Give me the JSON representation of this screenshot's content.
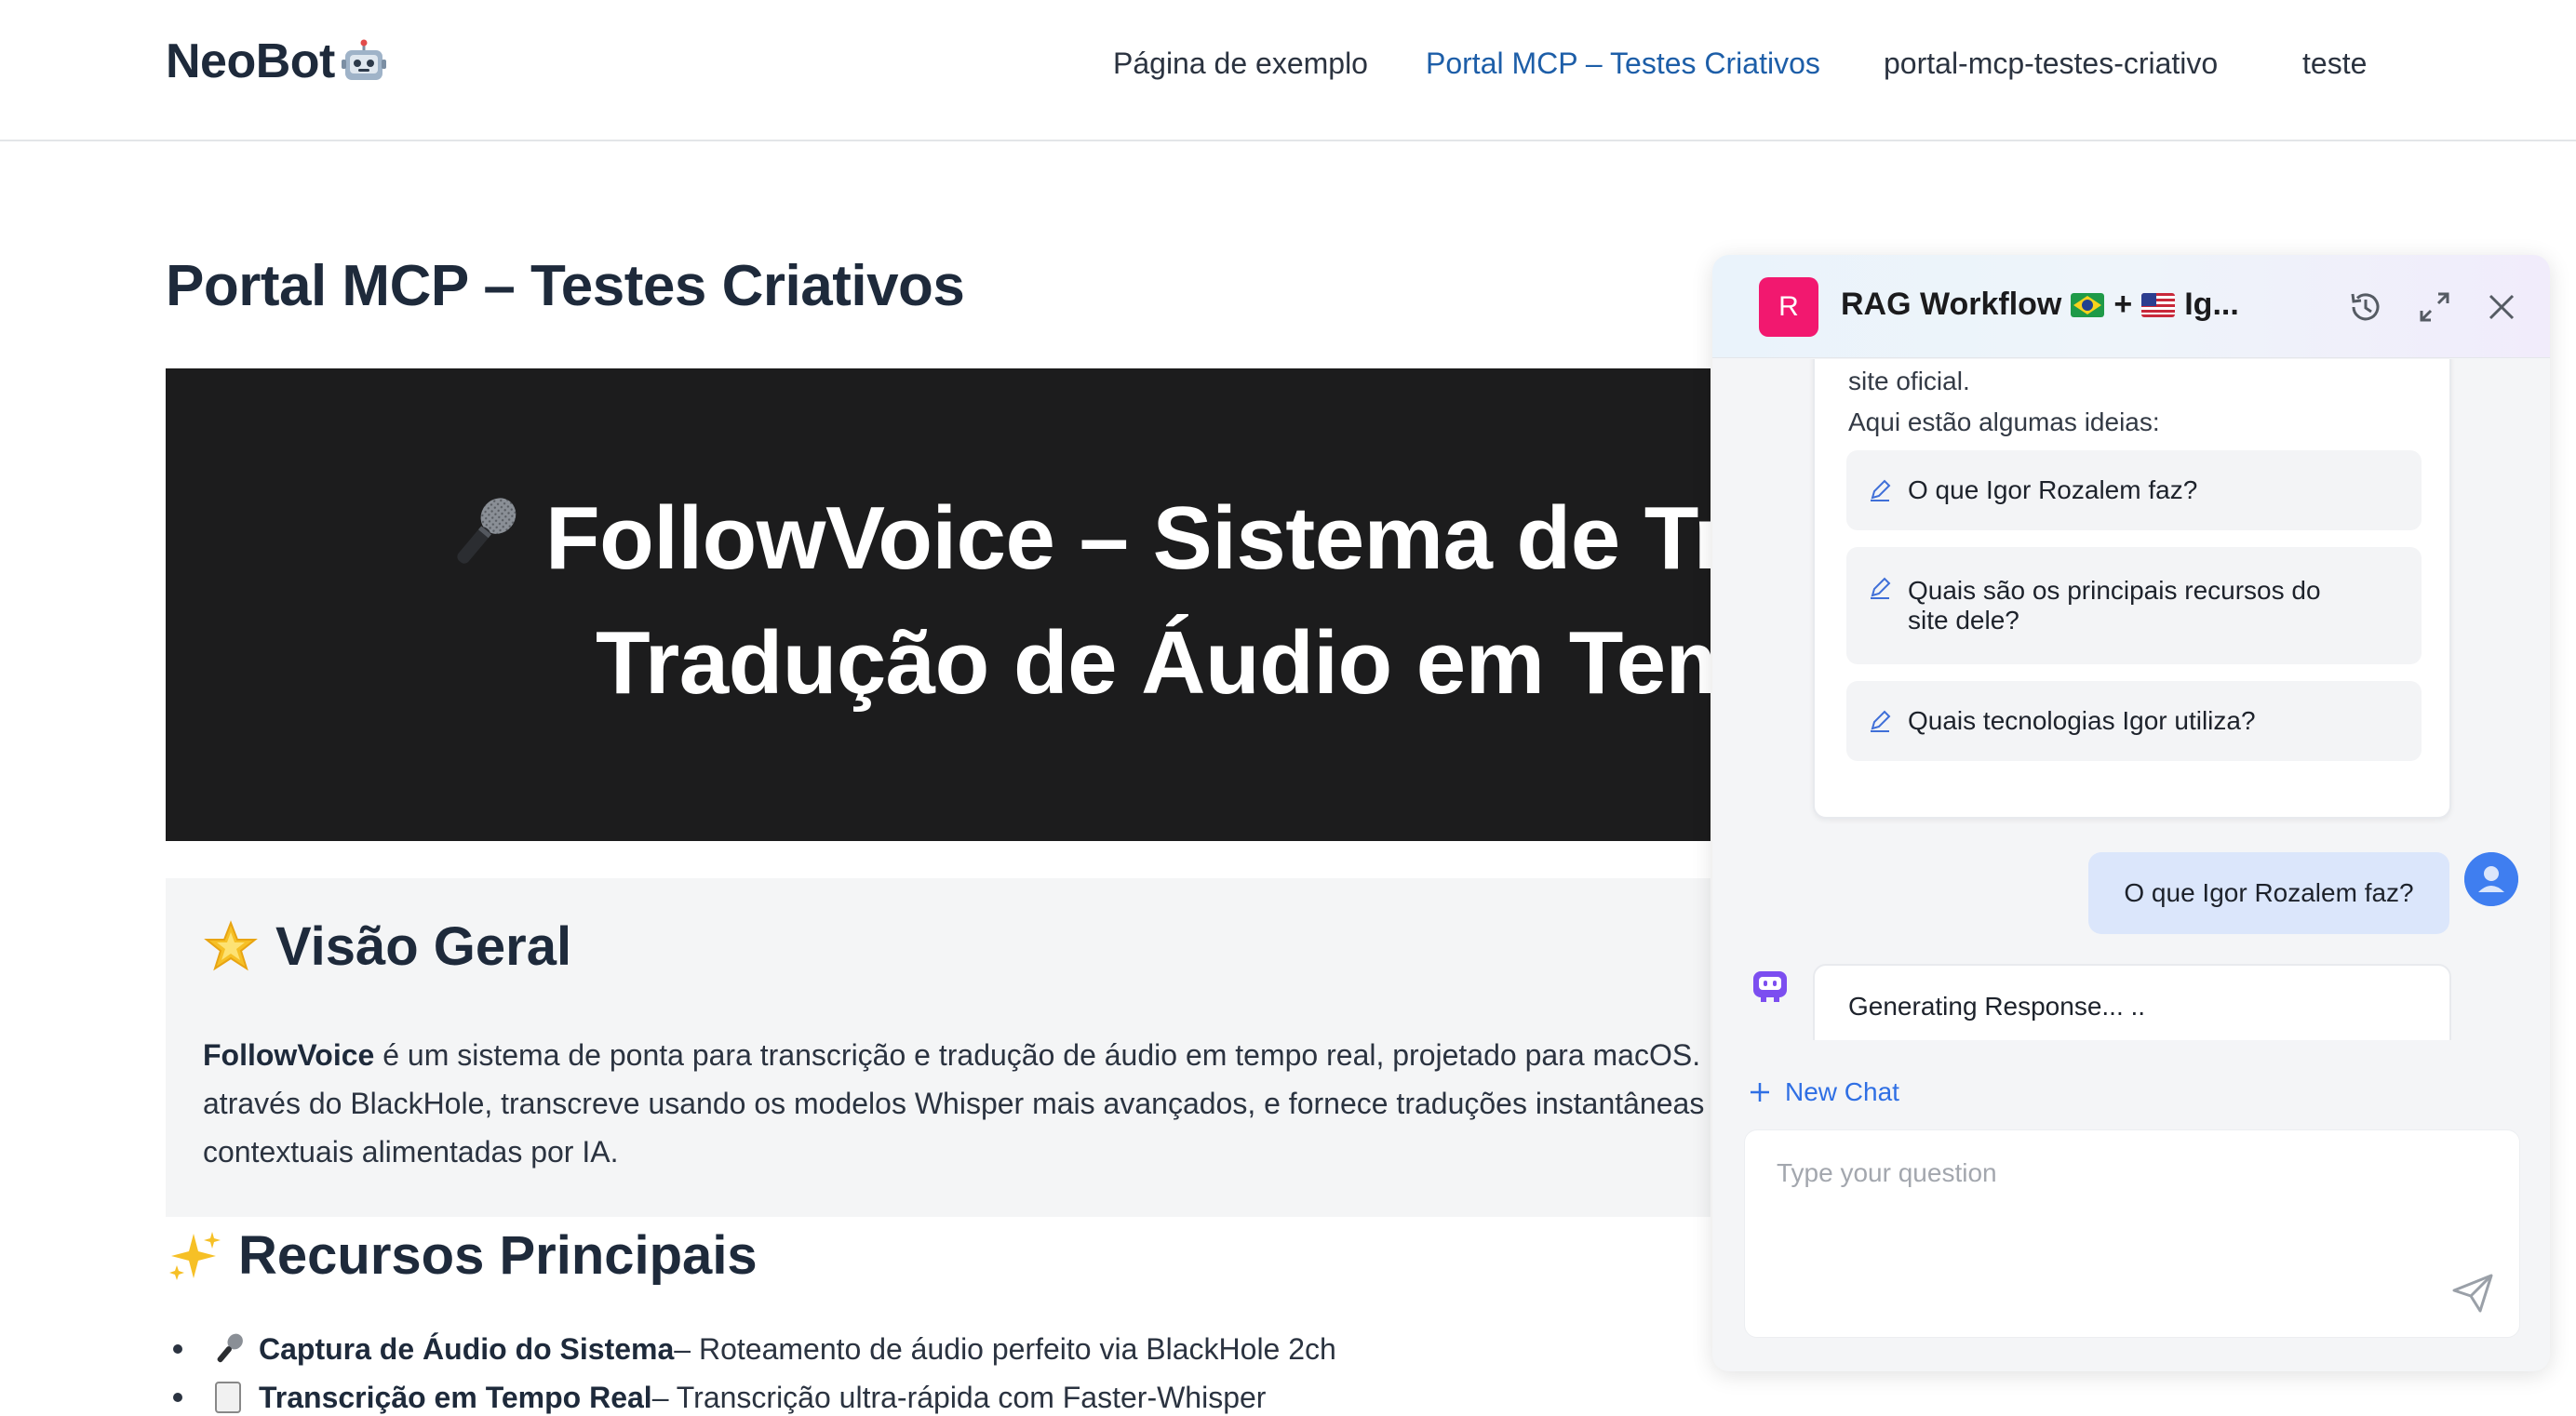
{
  "header": {
    "brand": "NeoBot",
    "nav": [
      {
        "label": "Página de exemplo",
        "active": false
      },
      {
        "label": "Portal MCP – Testes Criativos",
        "active": true
      },
      {
        "label": "portal-mcp-testes-criativo",
        "active": false
      },
      {
        "label": "teste",
        "active": false
      }
    ]
  },
  "page": {
    "title": "Portal MCP – Testes Criativos",
    "hero": {
      "line1": "FollowVoice – Sistema de Transcrição e",
      "line2": "Tradução de Áudio em Tempo Real"
    },
    "overview": {
      "heading": "Visão Geral",
      "bold": "FollowVoice",
      "line1": " é um sistema de ponta para transcrição e tradução de áudio em tempo real, projetado para macOS. Ele captura o áudio do sistema",
      "line2": "através do BlackHole, transcreve usando os modelos Whisper mais avançados, e fornece traduções instantâneas e",
      "line3": "contextuais alimentadas por IA."
    },
    "features": {
      "heading": "Recursos Principais",
      "items": [
        {
          "bold": "Captura de Áudio do Sistema",
          "text": " – Roteamento de áudio perfeito via BlackHole 2ch"
        },
        {
          "bold": "Transcrição em Tempo Real",
          "text": " – Transcrição ultra-rápida com Faster-Whisper"
        }
      ]
    }
  },
  "chat": {
    "logo_letter": "R",
    "title_prefix": "RAG Workflow",
    "title_plus": "+",
    "title_suffix": "Ig...",
    "intro_tail": "site oficial.",
    "ideas_label": "Aqui estão algumas ideias:",
    "suggestions": [
      "O que Igor Rozalem faz?",
      "Quais são os principais recursos do",
      "site dele?",
      "Quais tecnologias Igor utiliza?"
    ],
    "user_message": "O que Igor Rozalem faz?",
    "generating": "Generating Response... ..",
    "new_chat": "New Chat",
    "input_placeholder": "Type your question"
  },
  "colors": {
    "accent_link": "#1d5ea8",
    "chat_logo": "#f2186f",
    "chat_accent": "#2f6fe4",
    "user_bubble": "#dbe6fb"
  },
  "icons": [
    "robot-icon",
    "microphone-icon",
    "star-icon",
    "sparkles-icon",
    "history-icon",
    "expand-icon",
    "close-icon",
    "pencil-icon",
    "user-avatar-icon",
    "bot-icon",
    "plus-icon",
    "send-icon",
    "brazil-flag-icon",
    "us-flag-icon"
  ]
}
